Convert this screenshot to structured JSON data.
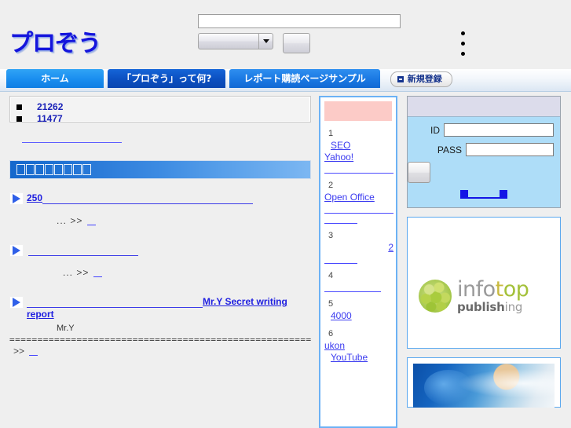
{
  "site": {
    "logo_text": "プロぞう"
  },
  "search": {
    "keyword_value": "",
    "keyword_placeholder": "",
    "category_selected": "",
    "submit_label": ""
  },
  "header_links": [
    {
      "label": ""
    },
    {
      "label": ""
    },
    {
      "label": ""
    }
  ],
  "nav": {
    "tabs": [
      {
        "label": "ホーム"
      },
      {
        "label": "「プロぞう」って何?"
      },
      {
        "label": "レポート購読ページサンプル"
      }
    ],
    "signup_label": "新規登録"
  },
  "stats": {
    "items": [
      {
        "value": "21262"
      },
      {
        "value": "11477"
      }
    ],
    "below_link_label": ""
  },
  "section": {
    "title_tofu_count": 8,
    "title": "��������"
  },
  "reports": [
    {
      "title_prefix": "250",
      "title_rest": "",
      "more_text": "... >>",
      "more_link_label": "",
      "byline": "",
      "separator": ""
    },
    {
      "title_prefix": "",
      "title_rest": "",
      "more_text": "... >>",
      "more_link_label": "",
      "byline": "",
      "separator": ""
    },
    {
      "title_prefix": "",
      "title_rest": "Mr.Y Secret writing report",
      "more_text": ">>",
      "more_link_label": "",
      "byline": "Mr.Y",
      "separator": "=========================================================..."
    }
  ],
  "ranking": {
    "header_label": "",
    "items": [
      {
        "rank": "1",
        "lines": [
          "SEO",
          "Yahoo!",
          ""
        ]
      },
      {
        "rank": "2",
        "lines": [
          "Open Office",
          "",
          ""
        ]
      },
      {
        "rank": "3",
        "lines": [
          "2",
          ""
        ]
      },
      {
        "rank": "4",
        "lines": [
          ""
        ]
      },
      {
        "rank": "5",
        "lines": [
          "4000"
        ]
      },
      {
        "rank": "6",
        "lines": [
          "ukon",
          "YouTube"
        ]
      }
    ]
  },
  "login": {
    "id_label": "ID",
    "id_value": "",
    "pass_label": "PASS",
    "pass_value": "",
    "submit_label": "",
    "link_left_label": "",
    "link_right_label": ""
  },
  "sponsor": {
    "logo_info": "info",
    "logo_top": "top",
    "logo_publish": "publish",
    "logo_ing": "ing"
  },
  "colors": {
    "brand_blue": "#1414dc",
    "tab_active": "#0b4fc0",
    "link_blue": "#2020e0",
    "rank_header": "#fccbc7",
    "login_bg": "#aeddf8"
  }
}
